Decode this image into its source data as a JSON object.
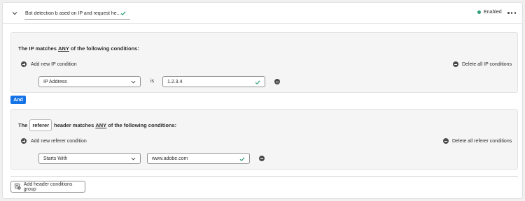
{
  "rule": {
    "name": "Bot detection b ased on IP and request he...",
    "status": "Enabled",
    "status_color": "#2d9d78",
    "icons": {
      "collapse": "chevron-down-icon",
      "more": "more-horizontal-icon",
      "valid": "checkmark-icon"
    }
  },
  "ip_group": {
    "title_prefix": "The IP matches",
    "title_keyword": "ANY",
    "title_suffix": "of the following conditions:",
    "add_label": "Add new IP condition",
    "delete_all_label": "Delete all IP conditions",
    "condition": {
      "field": "IP Address",
      "operator": "is",
      "value": "1.2.3.4"
    }
  },
  "connector": {
    "label": "And",
    "color": "#1473e6"
  },
  "referer_group": {
    "title_prefix": "The",
    "header_name": "referer",
    "title_middle": "header matches",
    "title_keyword": "ANY",
    "title_suffix": "of the following conditions:",
    "add_label": "Add new referer condition",
    "delete_all_label": "Delete all referer conditions",
    "condition": {
      "operator": "Starts With",
      "value": "www.adobe.com"
    }
  },
  "footer": {
    "add_group_label": "Add header conditions group"
  }
}
